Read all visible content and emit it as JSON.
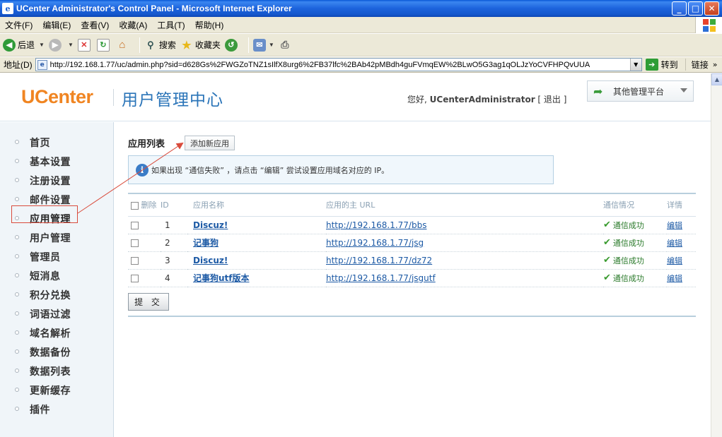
{
  "window": {
    "title": "UCenter Administrator's Control Panel - Microsoft Internet Explorer",
    "controls": [
      "_",
      "□",
      "✕"
    ]
  },
  "menu": [
    "文件(F)",
    "编辑(E)",
    "查看(V)",
    "收藏(A)",
    "工具(T)",
    "帮助(H)"
  ],
  "toolbar": {
    "back": "后退",
    "search": "搜索",
    "favorites": "收藏夹"
  },
  "address": {
    "label": "地址(D)",
    "url": "http://192.168.1.77/uc/admin.php?sid=d628Gs%2FWGZoTNZ1sIlfX8urg6%2FB37lfc%2BAb42pMBdh4guFVmqEW%2BLwO5G3ag1qOLJzYoCVFHPQvUUA",
    "go": "转到",
    "links": "链接"
  },
  "header": {
    "brand": "UCenter",
    "subtitle": "用户管理中心",
    "greeting": "您好, ",
    "username": "UCenterAdministrator",
    "logout_open": " [ ",
    "logout": "退出",
    "logout_close": " ]",
    "platform": "其他管理平台"
  },
  "sidebar": {
    "items": [
      {
        "label": "首页"
      },
      {
        "label": "基本设置"
      },
      {
        "label": "注册设置"
      },
      {
        "label": "邮件设置"
      },
      {
        "label": "应用管理"
      },
      {
        "label": "用户管理"
      },
      {
        "label": "管理员"
      },
      {
        "label": "短消息"
      },
      {
        "label": "积分兑换"
      },
      {
        "label": "词语过滤"
      },
      {
        "label": "域名解析"
      },
      {
        "label": "数据备份"
      },
      {
        "label": "数据列表"
      },
      {
        "label": "更新缓存"
      },
      {
        "label": "插件"
      }
    ]
  },
  "content": {
    "title": "应用列表",
    "add_button": "添加新应用",
    "notice": "如果出现 “通信失败” ，请点击 “编辑” 尝试设置应用域名对应的 IP。",
    "columns": {
      "delete": "删除",
      "id": "ID",
      "name": "应用名称",
      "url": "应用的主 URL",
      "status": "通信情况",
      "detail": "详情"
    },
    "rows": [
      {
        "id": "1",
        "name": "Discuz!",
        "url": "http://192.168.1.77/bbs",
        "status": "通信成功",
        "detail": "编辑"
      },
      {
        "id": "2",
        "name": "记事狗",
        "url": "http://192.168.1.77/jsg",
        "status": "通信成功",
        "detail": "编辑"
      },
      {
        "id": "3",
        "name": "Discuz!",
        "url": "http://192.168.1.77/dz72",
        "status": "通信成功",
        "detail": "编辑"
      },
      {
        "id": "4",
        "name": "记事狗utf版本",
        "url": "http://192.168.1.77/jsgutf",
        "status": "通信成功",
        "detail": "编辑"
      }
    ],
    "submit": "提 交"
  },
  "colors": {
    "brand_orange": "#f08522",
    "title_blue": "#2a74b8",
    "link_blue": "#1d5aa5",
    "success_green": "#2a7a2a",
    "annotation_red": "#d94b3c"
  }
}
